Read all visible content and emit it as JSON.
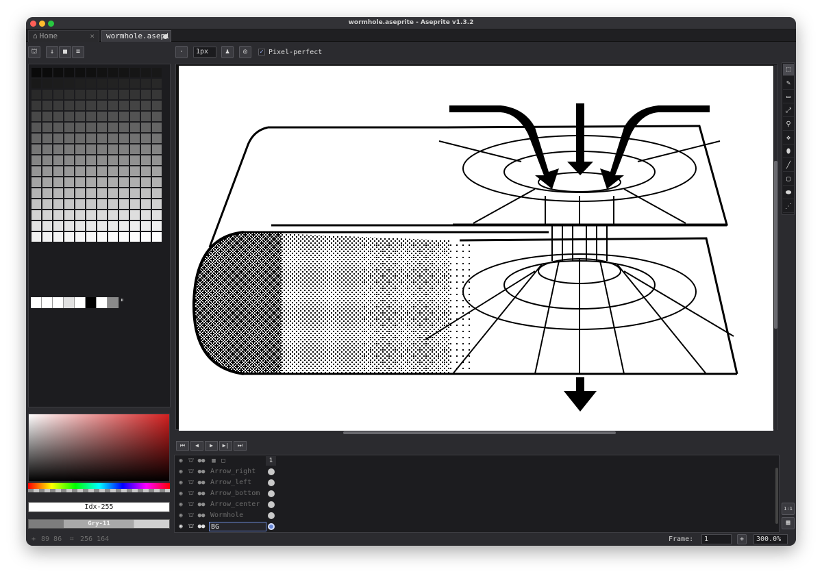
{
  "window": {
    "title": "wormhole.aseprite - Aseprite v1.3.2"
  },
  "tabs": [
    {
      "label": "Home",
      "close": "×"
    },
    {
      "label": "wormhole.asepi"
    }
  ],
  "palette_toolbar": {
    "icons": [
      "lock-icon",
      "arrow-down-icon",
      "save-icon",
      "menu-icon"
    ]
  },
  "brush_toolbar": {
    "brush_size": "1px",
    "pixel_perfect_label": "Pixel-perfect",
    "pixel_perfect_checked": true
  },
  "palette": {
    "swatch_count": 192,
    "extra_row": [
      "#ffffff",
      "#ffffff",
      "#ffffff",
      "#e0e0e0",
      "#ffffff",
      "#000000",
      "#ffffff",
      "#8a8a8a"
    ],
    "extra_marker": "⏸"
  },
  "color_picker": {
    "index_label": "Idx-255",
    "gray_label": "Gry-11"
  },
  "tools": [
    "marquee-icon",
    "pencil-icon",
    "eraser-icon",
    "eyedropper-icon",
    "zoom-icon",
    "move-icon",
    "fill-icon",
    "line-icon",
    "rectangle-icon",
    "ellipse-icon",
    "blur-icon"
  ],
  "playback": [
    "⏮",
    "◀",
    "▶",
    "▶|",
    "⏭"
  ],
  "timeline": {
    "frame_header": "1",
    "layers": [
      {
        "name": "Arrow_right",
        "visible": true
      },
      {
        "name": "Arrow_left",
        "visible": true
      },
      {
        "name": "Arrow_bottom",
        "visible": true
      },
      {
        "name": "Arrow_center",
        "visible": true
      },
      {
        "name": "Wormhole",
        "visible": true
      },
      {
        "name": "BG",
        "visible": true,
        "selected": true
      }
    ]
  },
  "statusbar": {
    "cursor_pos": "89 86",
    "sprite_size": "256 164",
    "frame_label": "Frame:",
    "frame_value": "1",
    "add_label": "+",
    "zoom": "300.0%"
  },
  "right_panel": {
    "ratio_label": "1:1"
  }
}
